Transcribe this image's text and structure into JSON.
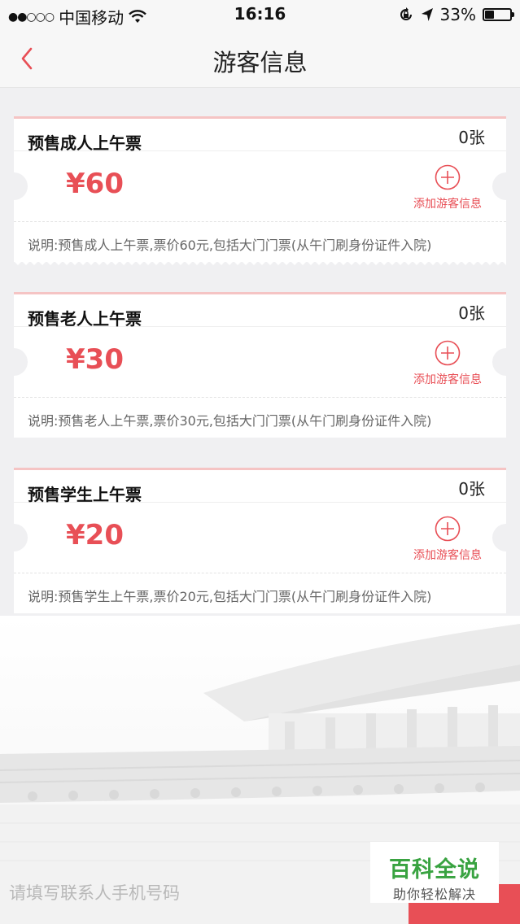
{
  "status_bar": {
    "signal": "●●○○○",
    "carrier": "中国移动",
    "time": "16:16",
    "battery_text": "33%",
    "battery_level": 0.33
  },
  "nav": {
    "title": "游客信息"
  },
  "tickets": [
    {
      "name": "预售成人上午票",
      "count": "0张",
      "price": "¥60",
      "add_label": "添加游客信息",
      "description": "说明:预售成人上午票,票价60元,包括大门门票(从午门刷身份证件入院)"
    },
    {
      "name": "预售老人上午票",
      "count": "0张",
      "price": "¥30",
      "add_label": "添加游客信息",
      "description": "说明:预售老人上午票,票价30元,包括大门门票(从午门刷身份证件入院)"
    },
    {
      "name": "预售学生上午票",
      "count": "0张",
      "price": "¥20",
      "add_label": "添加游客信息",
      "description": "说明:预售学生上午票,票价20元,包括大门门票(从午门刷身份证件入院)"
    }
  ],
  "contact": {
    "placeholder": "请填写联系人手机号码"
  },
  "watermark": {
    "title": "百科全说",
    "subtitle": "助你轻松解决"
  },
  "colors": {
    "accent": "#e84f56",
    "watermark_green": "#39a341",
    "background": "#f0f0f2"
  }
}
